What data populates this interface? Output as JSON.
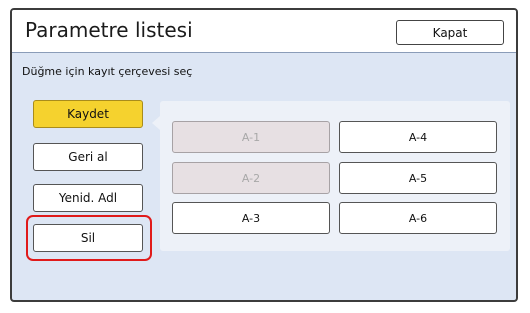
{
  "window": {
    "title": "Parametre listesi",
    "close_label": "Kapat"
  },
  "instruction": "Düğme için kayıt çerçevesi seç",
  "actions": [
    {
      "label": "Kaydet",
      "state": "active"
    },
    {
      "label": "Geri al",
      "state": "normal"
    },
    {
      "label": "Yenid. Adl",
      "state": "normal"
    },
    {
      "label": "Sil",
      "state": "highlighted"
    }
  ],
  "slots": [
    {
      "label": "A-1",
      "enabled": false
    },
    {
      "label": "A-2",
      "enabled": false
    },
    {
      "label": "A-3",
      "enabled": true
    },
    {
      "label": "A-4",
      "enabled": true
    },
    {
      "label": "A-5",
      "enabled": true
    },
    {
      "label": "A-6",
      "enabled": true
    }
  ],
  "colors": {
    "active_button": "#f5d22e",
    "highlight_outline": "#e01a1a",
    "background": "#dde6f4"
  }
}
